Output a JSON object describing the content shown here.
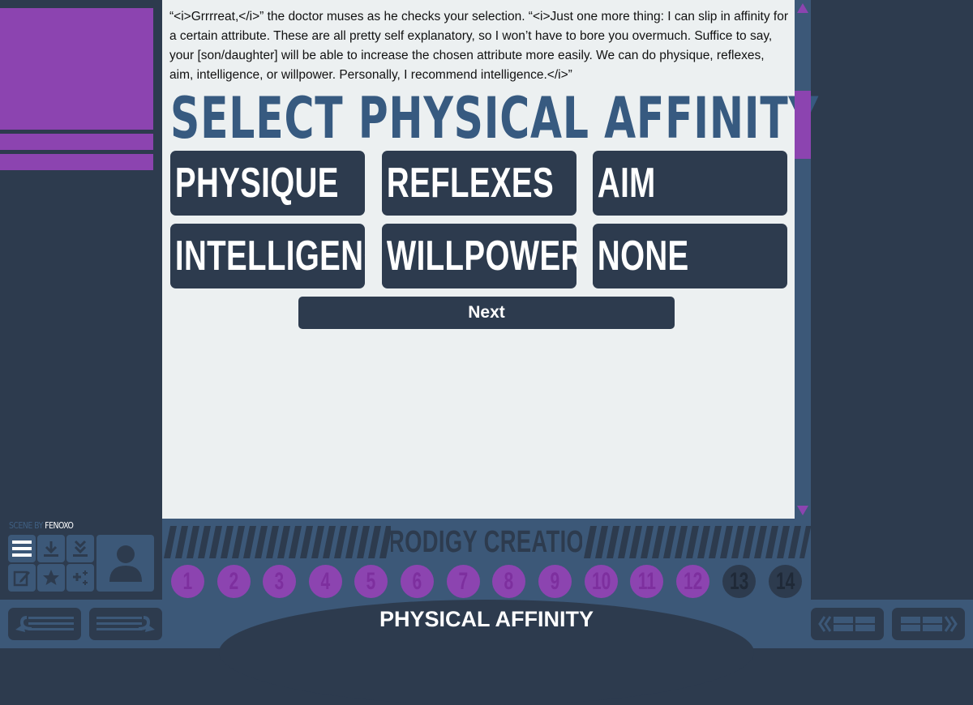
{
  "author": {
    "prefix": "SCENE BY",
    "name": "FENOXO"
  },
  "story_text": "“<i>Grrrreat,</i>” the doctor muses as he checks your selection. “<i>Just one more thing: I can slip in affinity for a certain attribute. These are all pretty self explanatory, so I won’t have to bore you overmuch. Suffice to say, your [son/daughter] will be able to increase the chosen attribute more easily. We can do physique, reflexes, aim, intelligence, or willpower. Personally, I recommend intelligence.</i>”",
  "heading": "SELECT PHYSICAL AFFINITY",
  "options": [
    "PHYSIQUE",
    "REFLEXES",
    "AIM",
    "INTELLIGENCE",
    "WILLPOWER",
    "NONE"
  ],
  "next_label": "Next",
  "progress": {
    "title": "PRODIGY CREATION",
    "steps": [
      "1",
      "2",
      "3",
      "4",
      "5",
      "6",
      "7",
      "8",
      "9",
      "10",
      "11",
      "12",
      "13",
      "14"
    ],
    "completed": 12
  },
  "scene_title": "PHYSICAL AFFINITY",
  "sidebar_icons": [
    "menu-icon",
    "save-icon",
    "load-icon",
    "notes-icon",
    "star-icon",
    "perks-icon",
    "character-icon"
  ],
  "colors": {
    "accent": "#8c44b0",
    "dark": "#2d3b4e",
    "mid": "#3c5878",
    "panel": "#ecf0f1",
    "heading": "#375a80"
  }
}
